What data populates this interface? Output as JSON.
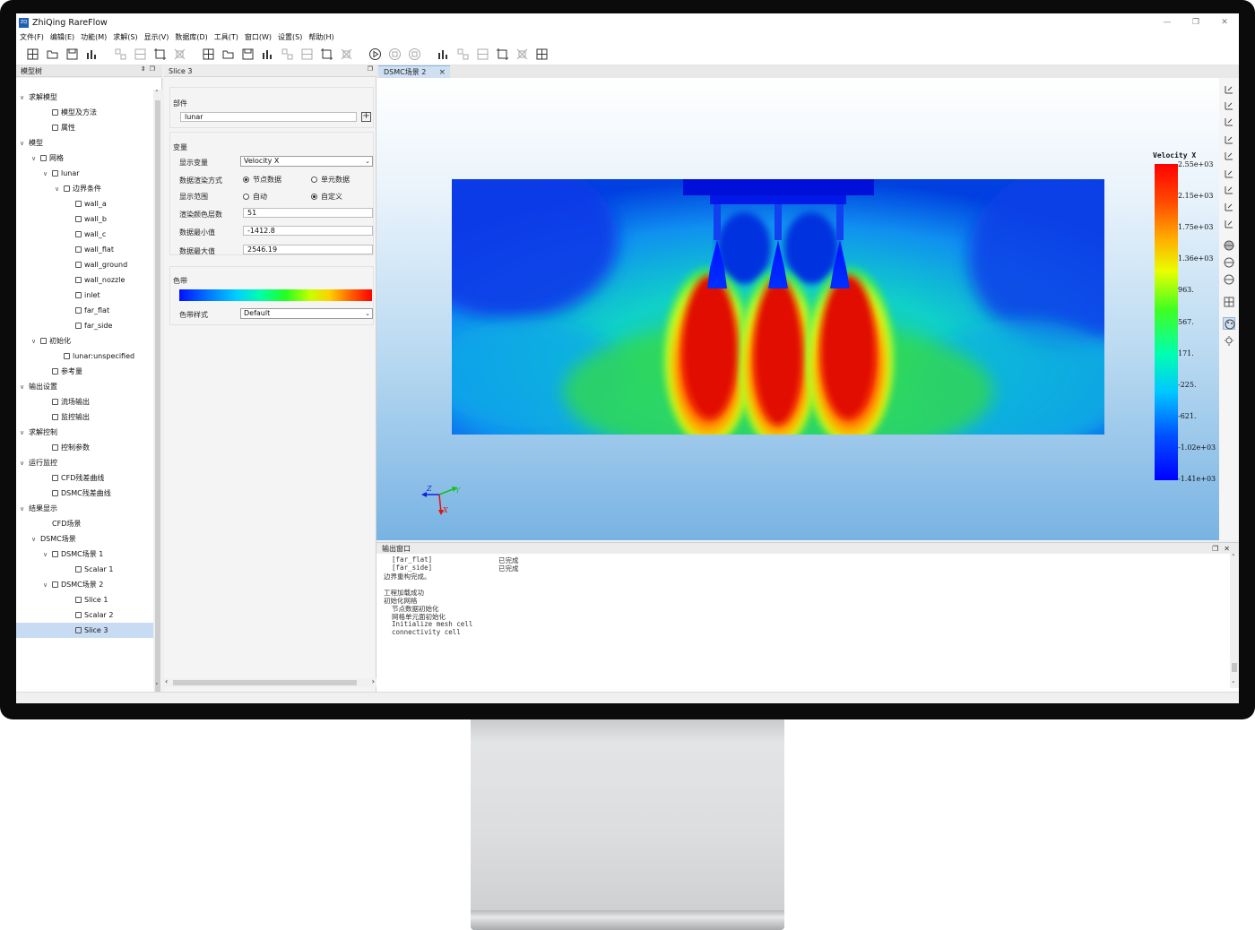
{
  "window": {
    "title": "ZhiQing RareFlow",
    "logo_glyph": "ZQ"
  },
  "menu": [
    "文件(F)",
    "编辑(E)",
    "功能(M)",
    "求解(S)",
    "显示(V)",
    "数据库(D)",
    "工具(T)",
    "窗口(W)",
    "设置(S)",
    "帮助(H)"
  ],
  "toolbar_icons": [
    "new-mesh-icon",
    "open-icon",
    "save-icon",
    "chart-icon",
    "grid-icon",
    "grid2-icon",
    "fit-icon",
    "transform-icon",
    "boundary-icon",
    "settings-icon",
    "function-icon",
    "monitor-icon",
    "mirror-icon",
    "probe-icon",
    "split-icon",
    "plot-icon",
    "run-icon",
    "pause-icon",
    "stop-icon",
    "residual-icon",
    "curve-icon",
    "target-icon",
    "target2-icon",
    "sort-icon",
    "sort2-icon"
  ],
  "tree": {
    "title": "模型树",
    "items": [
      {
        "label": "求解模型",
        "depth": 0,
        "arrow": "v",
        "icon": false
      },
      {
        "label": "模型及方法",
        "depth": 2,
        "arrow": "",
        "icon": true
      },
      {
        "label": "属性",
        "depth": 2,
        "arrow": "",
        "icon": true
      },
      {
        "label": "模型",
        "depth": 0,
        "arrow": "v",
        "icon": false
      },
      {
        "label": "网格",
        "depth": 1,
        "arrow": "v",
        "icon": true
      },
      {
        "label": "lunar",
        "depth": 2,
        "arrow": "v",
        "icon": true
      },
      {
        "label": "边界条件",
        "depth": 3,
        "arrow": "v",
        "icon": true
      },
      {
        "label": "wall_a",
        "depth": 4,
        "arrow": "",
        "icon": true
      },
      {
        "label": "wall_b",
        "depth": 4,
        "arrow": "",
        "icon": true
      },
      {
        "label": "wall_c",
        "depth": 4,
        "arrow": "",
        "icon": true
      },
      {
        "label": "wall_flat",
        "depth": 4,
        "arrow": "",
        "icon": true
      },
      {
        "label": "wall_ground",
        "depth": 4,
        "arrow": "",
        "icon": true
      },
      {
        "label": "wall_nozzle",
        "depth": 4,
        "arrow": "",
        "icon": true
      },
      {
        "label": "inlet",
        "depth": 4,
        "arrow": "",
        "icon": true
      },
      {
        "label": "far_flat",
        "depth": 4,
        "arrow": "",
        "icon": true
      },
      {
        "label": "far_side",
        "depth": 4,
        "arrow": "",
        "icon": true
      },
      {
        "label": "初始化",
        "depth": 1,
        "arrow": "v",
        "icon": true
      },
      {
        "label": "lunar:unspecified",
        "depth": 3,
        "arrow": "",
        "icon": true
      },
      {
        "label": "参考量",
        "depth": 2,
        "arrow": "",
        "icon": true
      },
      {
        "label": "输出设置",
        "depth": 0,
        "arrow": "v",
        "icon": false
      },
      {
        "label": "流场输出",
        "depth": 2,
        "arrow": "",
        "icon": true
      },
      {
        "label": "监控输出",
        "depth": 2,
        "arrow": "",
        "icon": true
      },
      {
        "label": "求解控制",
        "depth": 0,
        "arrow": "v",
        "icon": false
      },
      {
        "label": "控制参数",
        "depth": 2,
        "arrow": "",
        "icon": true
      },
      {
        "label": "运行监控",
        "depth": 0,
        "arrow": "v",
        "icon": false
      },
      {
        "label": "CFD残差曲线",
        "depth": 2,
        "arrow": "",
        "icon": true
      },
      {
        "label": "DSMC残差曲线",
        "depth": 2,
        "arrow": "",
        "icon": true
      },
      {
        "label": "结果显示",
        "depth": 0,
        "arrow": "v",
        "icon": false
      },
      {
        "label": "CFD场景",
        "depth": 2,
        "arrow": "",
        "icon": false
      },
      {
        "label": "DSMC场景",
        "depth": 1,
        "arrow": "v",
        "icon": false
      },
      {
        "label": "DSMC场景 1",
        "depth": 2,
        "arrow": "v",
        "icon": true
      },
      {
        "label": "Scalar 1",
        "depth": 4,
        "arrow": "",
        "icon": true
      },
      {
        "label": "DSMC场景 2",
        "depth": 2,
        "arrow": "v",
        "icon": true
      },
      {
        "label": "Slice 1",
        "depth": 4,
        "arrow": "",
        "icon": true
      },
      {
        "label": "Scalar 2",
        "depth": 4,
        "arrow": "",
        "icon": true
      },
      {
        "label": "Slice 3",
        "depth": 4,
        "arrow": "",
        "icon": true
      }
    ],
    "selected": 35
  },
  "props": {
    "title": "Slice 3",
    "part_group": "部件",
    "part_value": "lunar",
    "var_group": "变量",
    "display_var_label": "显示变量",
    "display_var_value": "Velocity X",
    "render_mode_label": "数据渲染方式",
    "render_opt1": "节点数据",
    "render_opt2": "单元数据",
    "range_label": "显示范围",
    "range_opt1": "自动",
    "range_opt2": "自定义",
    "levels_label": "渲染颜色层数",
    "levels_value": "51",
    "min_label": "数据最小值",
    "min_value": "-1412.8",
    "max_label": "数据最大值",
    "max_value": "2546.19",
    "colorbar_group": "色带",
    "colorbar_style_label": "色带样式",
    "colorbar_style_value": "Default"
  },
  "view": {
    "tab_label": "DSMC场景 2",
    "legend_title": "Velocity X",
    "legend_labels": [
      "2.55e+03",
      "2.15e+03",
      "1.75e+03",
      "1.36e+03",
      "963.",
      "567.",
      "171.",
      "-225.",
      "-621.",
      "-1.02e+03",
      "-1.41e+03"
    ],
    "axis_z": "Z",
    "axis_y": "Y",
    "axis_x": "X"
  },
  "output": {
    "title": "输出窗口",
    "lines": [
      {
        "text": "  [far_flat]",
        "status": "已完成"
      },
      {
        "text": "  [far_side]",
        "status": "已完成"
      },
      {
        "text": "边界重构完成。",
        "status": ""
      },
      {
        "text": "",
        "status": ""
      },
      {
        "text": "工程加载成功",
        "status": ""
      },
      {
        "text": "初始化网格",
        "status": ""
      },
      {
        "text": "  节点数据初始化",
        "status": ""
      },
      {
        "text": "  网格单元面初始化",
        "status": ""
      },
      {
        "text": "  Initialize mesh cell",
        "status": ""
      },
      {
        "text": "  connectivity cell",
        "status": ""
      }
    ]
  },
  "colors": {
    "accent": "#1e5fb4",
    "selection": "#c7dcf2",
    "tab": "#cfe0f3"
  }
}
